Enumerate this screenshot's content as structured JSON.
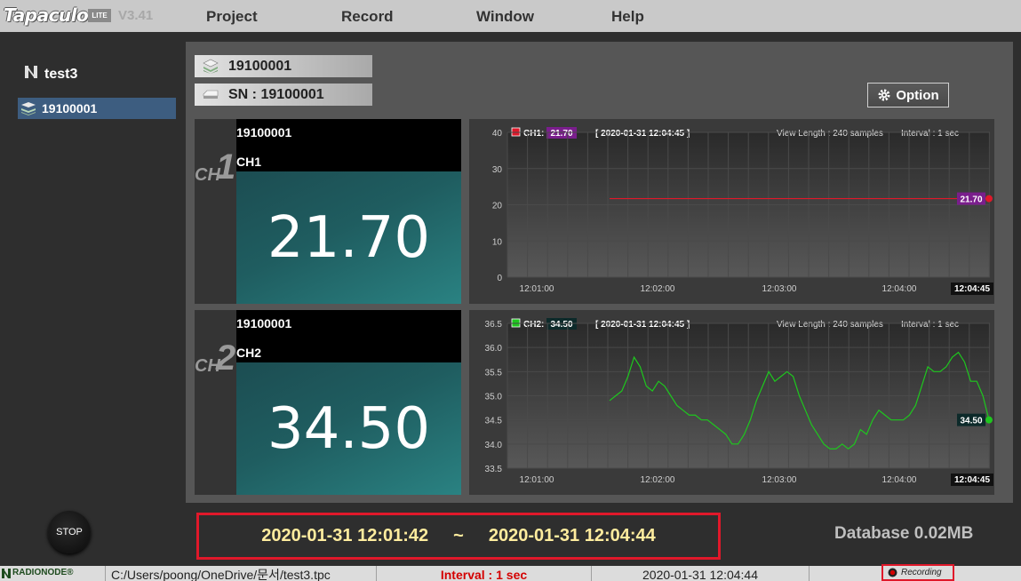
{
  "app": {
    "logo": "Tapaculo",
    "edition": "LITE",
    "version": "V3.41"
  },
  "menu": [
    "Project",
    "Record",
    "Window",
    "Help"
  ],
  "sidebar": {
    "project": "test3",
    "device": "19100001"
  },
  "header": {
    "device": "19100001",
    "serial": "SN : 19100001",
    "option": "Option"
  },
  "channels": [
    {
      "id": "1",
      "prefix": "CH",
      "serial": "19100001",
      "name": "CH1",
      "value": "21.70"
    },
    {
      "id": "2",
      "prefix": "CH",
      "serial": "19100001",
      "name": "CH2",
      "value": "34.50"
    }
  ],
  "chart_data": [
    {
      "type": "line",
      "legend": "CH1:",
      "badge": "21.70",
      "timestamp": "[ 2020-01-31 12:04:45 ]",
      "view_length": "View Length : 240 samples",
      "interval": "Interval : 1 sec",
      "color": "#e0182a",
      "badge_color": "#7a1e8c",
      "ylim": [
        0,
        40
      ],
      "yticks": [
        "40",
        "30",
        "20",
        "10",
        "0"
      ],
      "xticks": [
        "12:01:00",
        "12:02:00",
        "12:03:00",
        "12:04:00"
      ],
      "xlast": "12:04:45",
      "series": [
        {
          "values": [
            21.7,
            21.7,
            21.7,
            21.7,
            21.7,
            21.7,
            21.7,
            21.7,
            21.7,
            21.7,
            21.7,
            21.7,
            21.7,
            21.7,
            21.7,
            21.7
          ]
        }
      ],
      "end_value": "21.70"
    },
    {
      "type": "line",
      "legend": "CH2:",
      "badge": "34.50",
      "timestamp": "[ 2020-01-31 12:04:45 ]",
      "view_length": "View Length : 240 samples",
      "interval": "Interval : 1 sec",
      "color": "#1ec71e",
      "badge_color": "#0d2a2a",
      "ylim": [
        33.5,
        36.5
      ],
      "yticks": [
        "36.5",
        "36.0",
        "35.5",
        "35.0",
        "34.5",
        "34.0",
        "33.5"
      ],
      "xticks": [
        "12:01:00",
        "12:02:00",
        "12:03:00",
        "12:04:00"
      ],
      "xlast": "12:04:45",
      "series": [
        {
          "values": [
            34.9,
            35.0,
            35.1,
            35.4,
            35.8,
            35.6,
            35.2,
            35.1,
            35.3,
            35.2,
            35.0,
            34.8,
            34.7,
            34.6,
            34.6,
            34.5,
            34.5,
            34.4,
            34.3,
            34.2,
            34.0,
            34.0,
            34.2,
            34.5,
            34.9,
            35.2,
            35.5,
            35.3,
            35.4,
            35.5,
            35.4,
            35.0,
            34.7,
            34.4,
            34.2,
            34.0,
            33.9,
            33.9,
            34.0,
            33.9,
            34.0,
            34.3,
            34.2,
            34.5,
            34.7,
            34.6,
            34.5,
            34.5,
            34.5,
            34.6,
            34.8,
            35.2,
            35.6,
            35.5,
            35.5,
            35.6,
            35.8,
            35.9,
            35.7,
            35.3,
            35.3,
            35.0,
            34.5
          ]
        }
      ],
      "end_value": "34.50"
    }
  ],
  "bottom": {
    "stop": "STOP",
    "range_start": "2020-01-31 12:01:42",
    "range_sep": "~",
    "range_end": "2020-01-31 12:04:44",
    "database": "Database 0.02MB"
  },
  "status": {
    "brand": "RADIONODE®",
    "path": "C:/Users/poong/OneDrive/문서/test3.tpc",
    "interval": "Interval : 1 sec",
    "time": "2020-01-31 12:04:44",
    "recording": "Recording"
  }
}
